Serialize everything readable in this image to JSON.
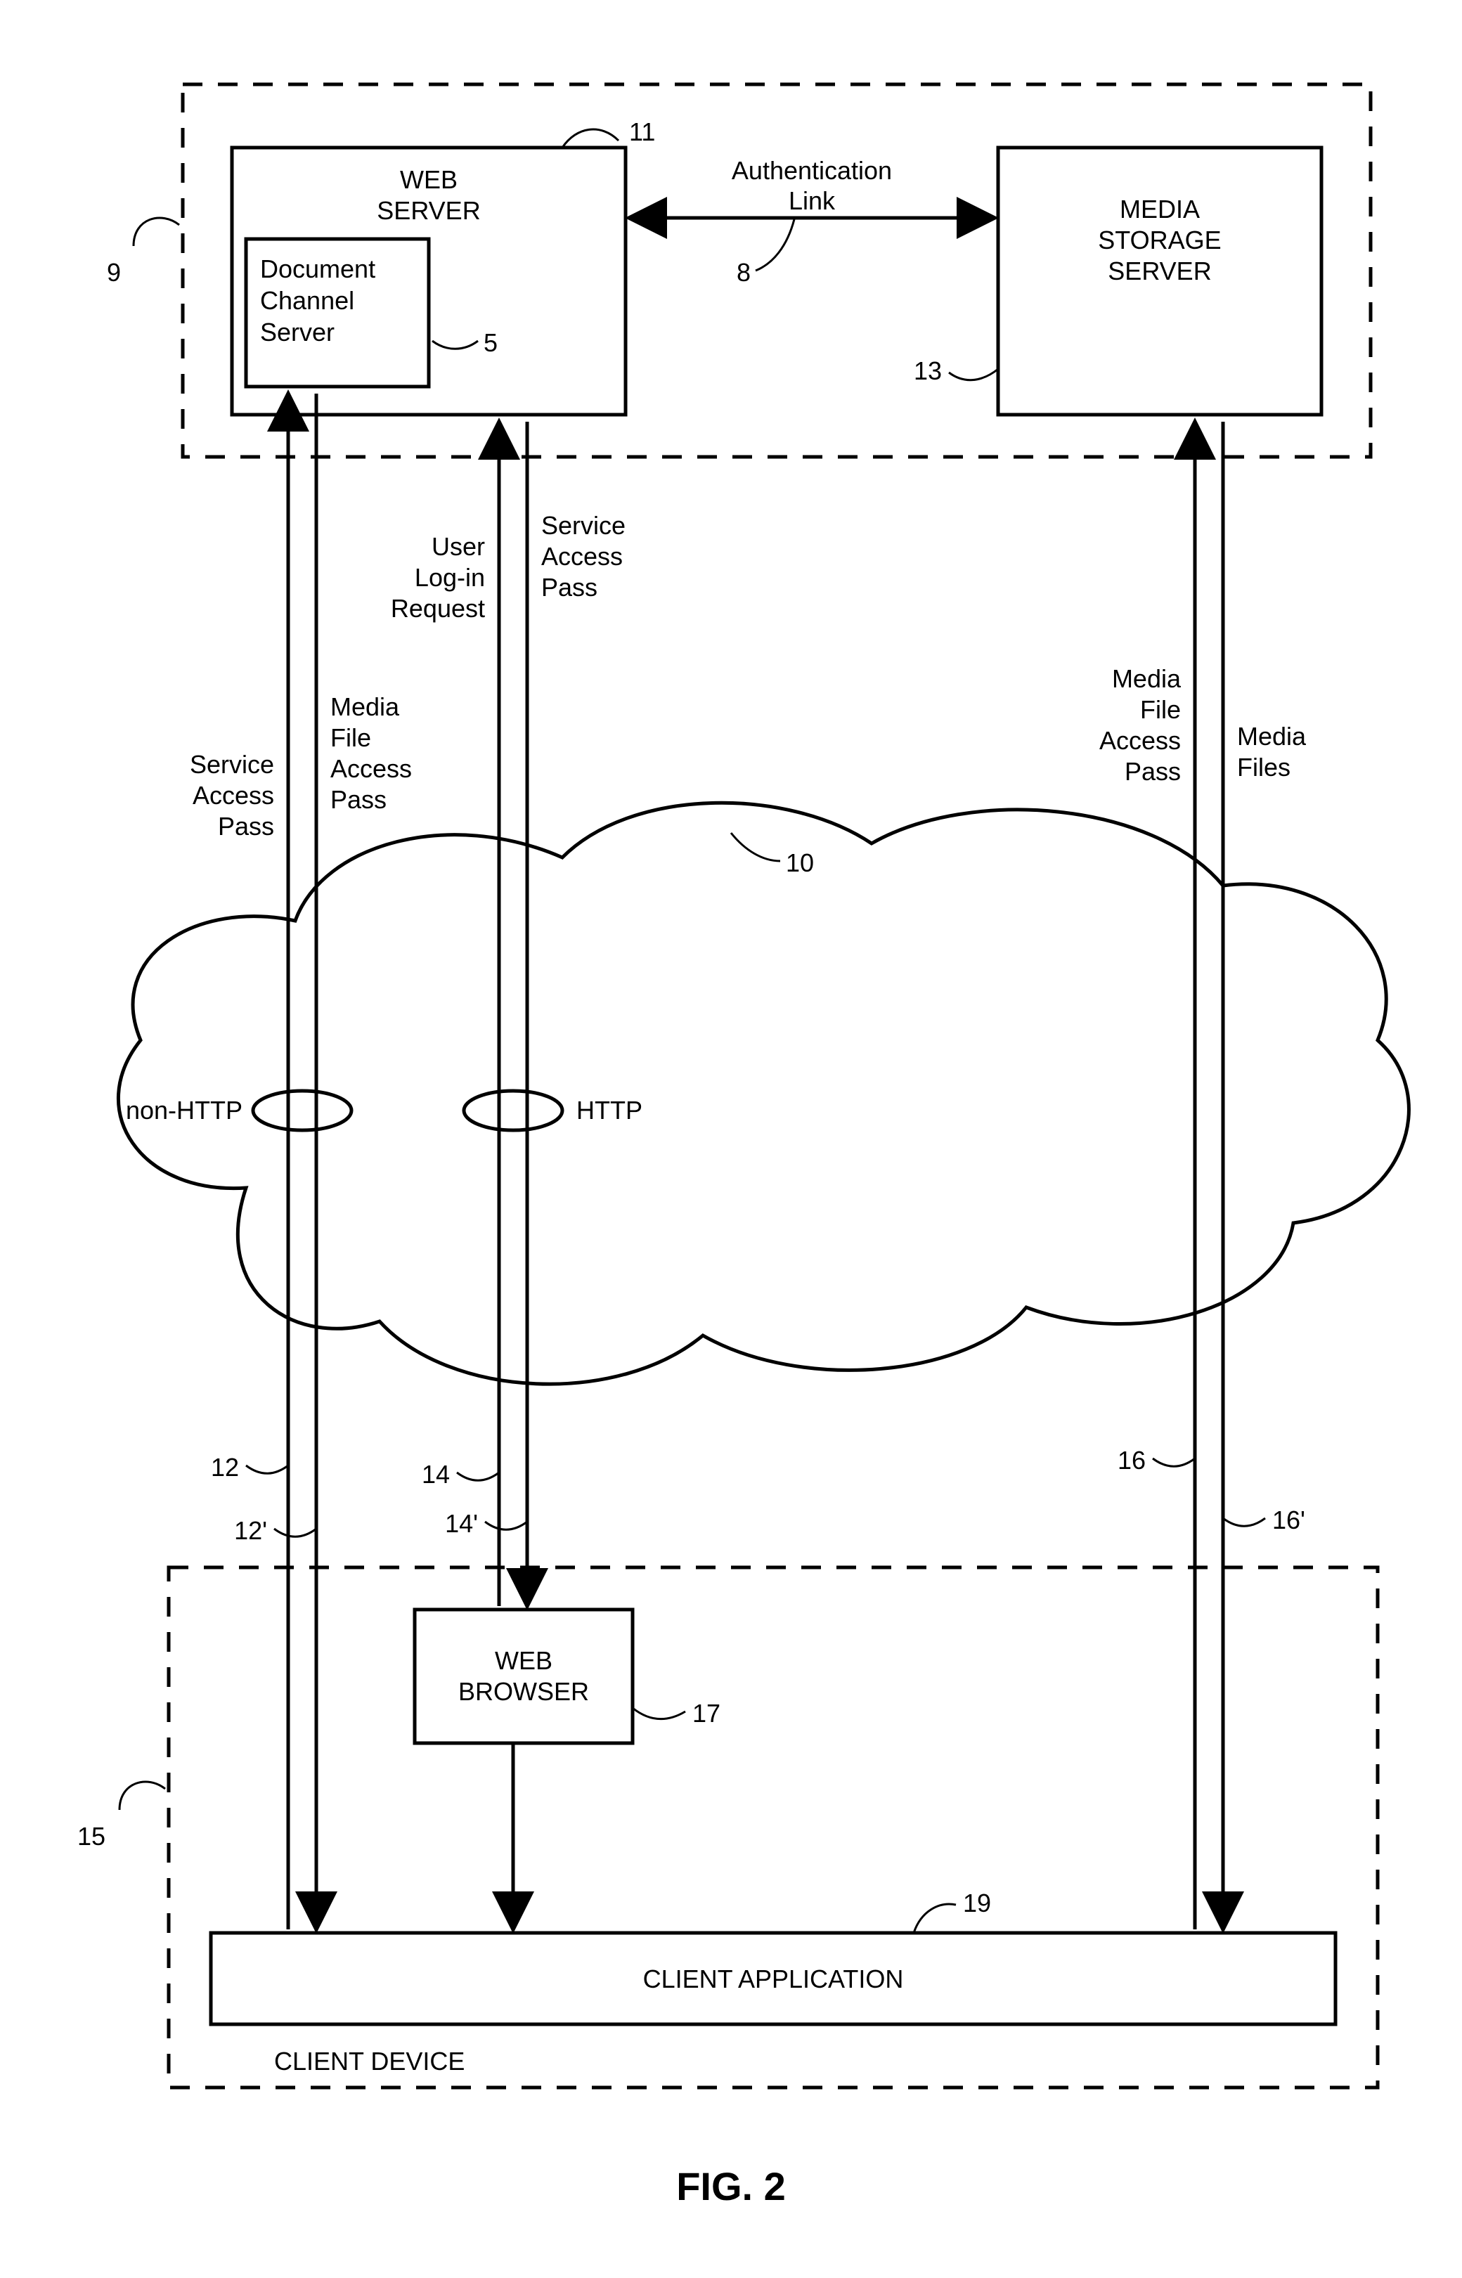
{
  "figure": "FIG. 2",
  "topGroup": {
    "ref": "9"
  },
  "webServer": {
    "label1": "WEB",
    "label2": "SERVER",
    "ref": "11"
  },
  "docChannel": {
    "label1": "Document",
    "label2": "Channel",
    "label3": "Server",
    "ref": "5"
  },
  "mediaServer": {
    "label1": "MEDIA",
    "label2": "STORAGE",
    "label3": "SERVER",
    "ref": "13"
  },
  "authLink": {
    "label1": "Authentication",
    "label2": "Link",
    "ref": "8"
  },
  "cloud": {
    "ref": "10"
  },
  "protocols": {
    "nonHttp": "non-HTTP",
    "http": "HTTP"
  },
  "leftPair": {
    "upLabel1": "Service",
    "upLabel2": "Access",
    "upLabel3": "Pass",
    "dnLabel1": "Media",
    "dnLabel2": "File",
    "dnLabel3": "Access",
    "dnLabel4": "Pass",
    "refUp": "12",
    "refDown": "12'"
  },
  "midPair": {
    "upLabel1": "User",
    "upLabel2": "Log-in",
    "upLabel3": "Request",
    "dnLabel1": "Service",
    "dnLabel2": "Access",
    "dnLabel3": "Pass",
    "refUp": "14",
    "refDown": "14'"
  },
  "rightPair": {
    "upLabel1": "Media",
    "upLabel2": "File",
    "upLabel3": "Access",
    "upLabel4": "Pass",
    "dnLabel1": "Media",
    "dnLabel2": "Files",
    "refUp": "16",
    "refDown": "16'"
  },
  "webBrowser": {
    "label1": "WEB",
    "label2": "BROWSER",
    "ref": "17"
  },
  "clientApp": {
    "label": "CLIENT APPLICATION",
    "ref": "19"
  },
  "clientDevice": {
    "label": "CLIENT DEVICE",
    "ref": "15"
  }
}
